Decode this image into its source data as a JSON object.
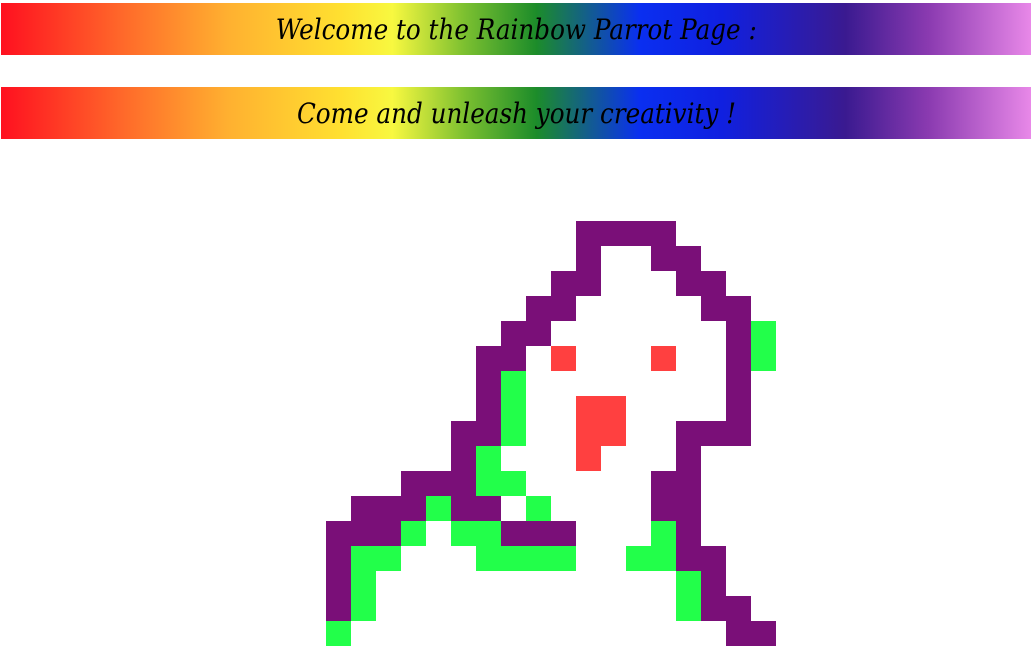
{
  "header": {
    "welcome_text": "Welcome to the Rainbow Parrot Page :",
    "tagline_text": "Come and unleash your creativity !"
  },
  "parrot_art": {
    "colors": {
      "outline": "#7a0f78",
      "accent": "#22ff4a",
      "eyes_beak": "#ff4040",
      "fill": "#ffffff"
    }
  }
}
